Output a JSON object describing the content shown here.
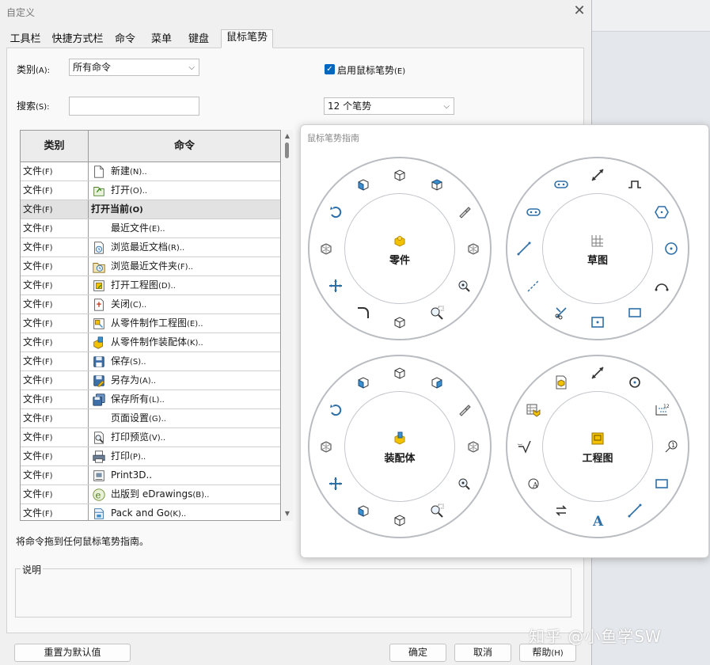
{
  "window": {
    "title": "自定义"
  },
  "tabs": [
    {
      "label": "工具栏"
    },
    {
      "label": "快捷方式栏"
    },
    {
      "label": "命令"
    },
    {
      "label": "菜单"
    },
    {
      "label": "键盘"
    },
    {
      "label": "鼠标笔势",
      "active": true
    }
  ],
  "filters": {
    "category_label": "类别",
    "category_hotkey": "(A):",
    "category_value": "所有命令",
    "search_label": "搜索",
    "search_hotkey": "(S):",
    "search_value": "",
    "enable_label": "启用鼠标笔势",
    "enable_hotkey": "(E)",
    "enable_checked": true,
    "gesture_count_value": "12 个笔势"
  },
  "table": {
    "headers": [
      "类别",
      "命令"
    ],
    "rows": [
      {
        "cat": "文件",
        "hot": "(F)",
        "cmd": "新建",
        "cmdhot": "(N)..",
        "icon": "new-document-icon"
      },
      {
        "cat": "文件",
        "hot": "(F)",
        "cmd": "打开",
        "cmdhot": "(O)..",
        "icon": "open-document-icon"
      },
      {
        "cat": "文件",
        "hot": "(F)",
        "cmd": "打开当前",
        "cmdhot": "(O)",
        "icon": "",
        "selected": true
      },
      {
        "cat": "文件",
        "hot": "(F)",
        "cmd": "最近文件",
        "cmdhot": "(E)..",
        "icon": ""
      },
      {
        "cat": "文件",
        "hot": "(F)",
        "cmd": "浏览最近文档",
        "cmdhot": "(R)..",
        "icon": "recent-documents-icon"
      },
      {
        "cat": "文件",
        "hot": "(F)",
        "cmd": "浏览最近文件夹",
        "cmdhot": "(F)..",
        "icon": "recent-folders-icon"
      },
      {
        "cat": "文件",
        "hot": "(F)",
        "cmd": "打开工程图",
        "cmdhot": "(D)..",
        "icon": "open-drawing-icon"
      },
      {
        "cat": "文件",
        "hot": "(F)",
        "cmd": "关闭",
        "cmdhot": "(C)..",
        "icon": "close-document-icon"
      },
      {
        "cat": "文件",
        "hot": "(F)",
        "cmd": "从零件制作工程图",
        "cmdhot": "(E)..",
        "icon": "make-drawing-icon"
      },
      {
        "cat": "文件",
        "hot": "(F)",
        "cmd": "从零件制作装配体",
        "cmdhot": "(K)..",
        "icon": "make-assembly-icon"
      },
      {
        "cat": "文件",
        "hot": "(F)",
        "cmd": "保存",
        "cmdhot": "(S)..",
        "icon": "save-icon"
      },
      {
        "cat": "文件",
        "hot": "(F)",
        "cmd": "另存为",
        "cmdhot": "(A)..",
        "icon": "save-as-icon"
      },
      {
        "cat": "文件",
        "hot": "(F)",
        "cmd": "保存所有",
        "cmdhot": "(L)..",
        "icon": "save-all-icon"
      },
      {
        "cat": "文件",
        "hot": "(F)",
        "cmd": "页面设置",
        "cmdhot": "(G)..",
        "icon": ""
      },
      {
        "cat": "文件",
        "hot": "(F)",
        "cmd": "打印预览",
        "cmdhot": "(V)..",
        "icon": "print-preview-icon"
      },
      {
        "cat": "文件",
        "hot": "(F)",
        "cmd": "打印",
        "cmdhot": "(P)..",
        "icon": "print-icon"
      },
      {
        "cat": "文件",
        "hot": "(F)",
        "cmd": "Print3D..",
        "cmdhot": "",
        "icon": "print3d-icon"
      },
      {
        "cat": "文件",
        "hot": "(F)",
        "cmd": "出版到 eDrawings",
        "cmdhot": "(B)..",
        "icon": "edrawings-icon"
      },
      {
        "cat": "文件",
        "hot": "(F)",
        "cmd": "Pack and Go",
        "cmdhot": "(K)..",
        "icon": "pack-and-go-icon"
      }
    ]
  },
  "hint": "将命令拖到任何鼠标笔势指南。",
  "description": {
    "label": "说明",
    "text": ""
  },
  "buttons": {
    "reset": "重置为默认值",
    "ok": "确定",
    "cancel": "取消",
    "help": "帮助",
    "help_hot": "(H)"
  },
  "guide": {
    "title": "鼠标笔势指南",
    "wheels": [
      {
        "label": "零件"
      },
      {
        "label": "草图"
      },
      {
        "label": "装配体"
      },
      {
        "label": "工程图"
      }
    ]
  },
  "watermark": "知乎 @小鱼学SW",
  "colors": {
    "accent": "#0067c0",
    "view_cube": "#3c8fce",
    "yellow": "#f2c200"
  }
}
